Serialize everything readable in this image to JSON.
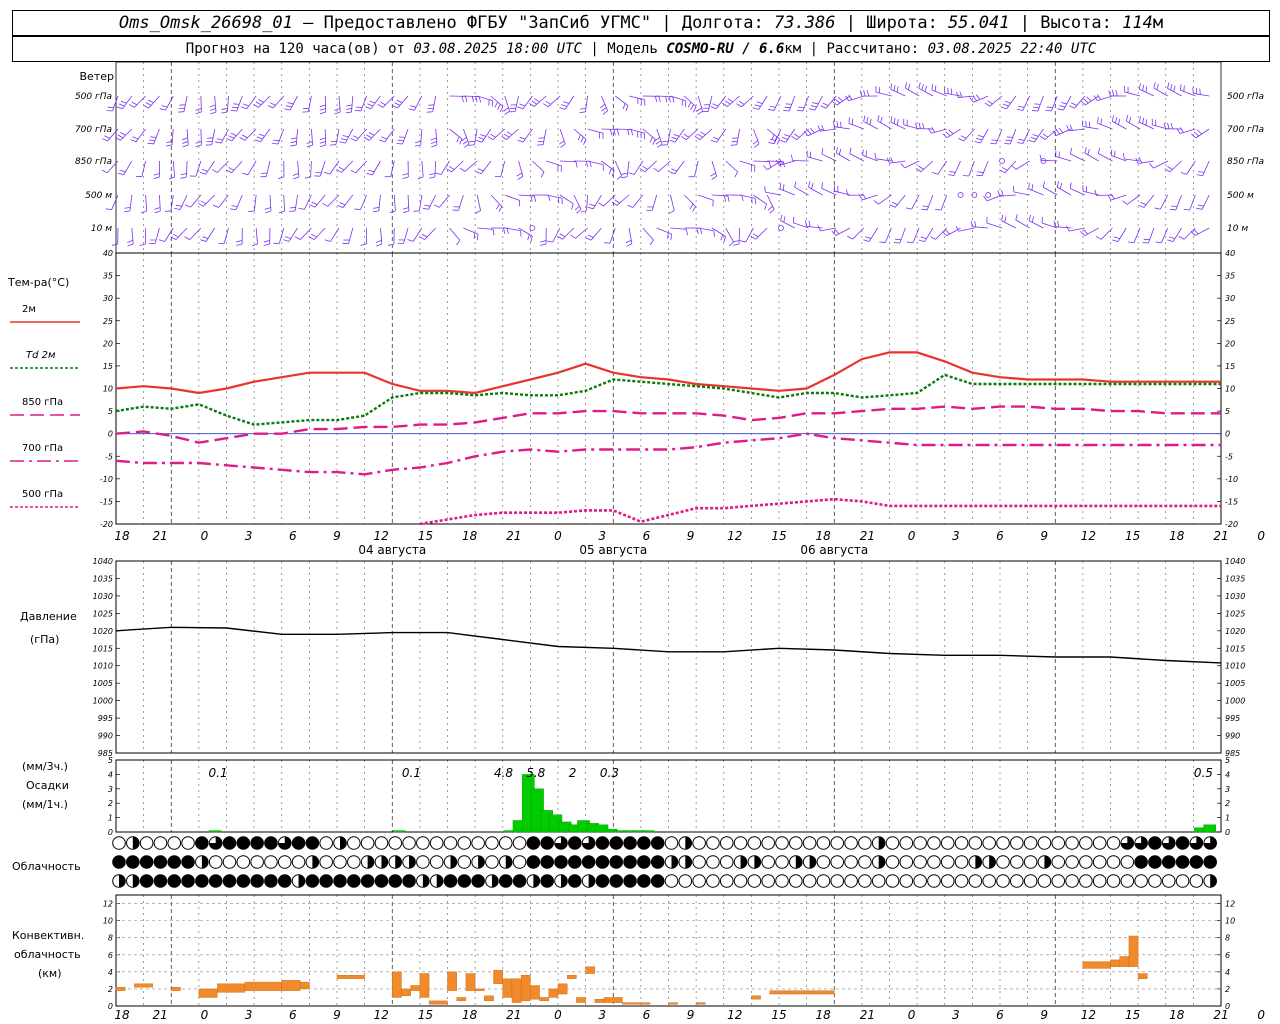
{
  "header": {
    "line1": {
      "station": "Oms_Omsk_26698_01",
      "provider": "– Предоставлено ФГБУ \"ЗапСиб УГМС\" |",
      "lon_label": "Долгота:",
      "lon": "73.386",
      "lat_label": "| Широта:",
      "lat": "55.041",
      "alt_label": "| Высота:",
      "alt": "114",
      "alt_unit": "м"
    },
    "line2": {
      "prefix": "Прогноз на 120 часа(ов) от",
      "start": "03.08.2025 18:00 UTC",
      "model_label": "| Модель",
      "model": "COSMO-RU / 6.6",
      "model_unit": "км",
      "calc_label": "| Рассчитано:",
      "calc": "03.08.2025 22:40 UTC"
    }
  },
  "time_axis": {
    "hour_labels": [
      "18",
      "21",
      "0",
      "3",
      "6",
      "9",
      "12",
      "15",
      "18",
      "21",
      "0",
      "3",
      "6",
      "9",
      "12",
      "15",
      "18",
      "21",
      "0",
      "3",
      "6",
      "9",
      "12",
      "15",
      "18",
      "21",
      "0"
    ],
    "day_labels": [
      "04 августа",
      "05 августа",
      "06 августа"
    ]
  },
  "wind_panel": {
    "title": "Ветер",
    "levels": [
      "500 гПа",
      "700 гПа",
      "850 гПа",
      "500 м",
      "10 м"
    ],
    "color": "#7b2ff0"
  },
  "colors": {
    "t2m": "#e8342c",
    "td2m": "#0a7a0a",
    "t850": "#dd1b8b",
    "t700": "#dd1b8b",
    "t500": "#dd1b8b",
    "precip": "#00cc00",
    "convective": "#f08a2a",
    "pressure": "#000000",
    "zero_line": "#3040c8"
  },
  "temp_panel": {
    "title": "Тем-ра(°С)",
    "legend": [
      "2м",
      "Td 2м",
      "850 гПа",
      "700 гПа",
      "500 гПа"
    ],
    "yticks": [
      "40",
      "35",
      "30",
      "25",
      "20",
      "15",
      "10",
      "5",
      "0",
      "-5",
      "-10",
      "-15",
      "-20"
    ]
  },
  "pressure_panel": {
    "title1": "Давление",
    "title2": "(гПа)",
    "yticks": [
      "1040",
      "1035",
      "1030",
      "1025",
      "1020",
      "1015",
      "1010",
      "1005",
      "1000",
      "995",
      "990",
      "985"
    ]
  },
  "precip_panel": {
    "label1": "(мм/3ч.)",
    "label2": "Осадки",
    "label3": "(мм/1ч.)",
    "yticks": [
      "5",
      "4",
      "3",
      "2",
      "1",
      "0"
    ],
    "annotations": [
      "0.1",
      "0.1",
      "4.8",
      "5.8",
      "2",
      "0.3",
      "0.5"
    ]
  },
  "cloud_panel": {
    "title": "Облачность"
  },
  "conv_panel": {
    "title1": "Конвективн.",
    "title2": "облачность",
    "title3": "(км)",
    "yticks": [
      "12",
      "10",
      "8",
      "6",
      "4",
      "2",
      "0"
    ]
  },
  "chart_data": [
    {
      "type": "line",
      "title": "Тем-ра(°С)",
      "x_hours": [
        0,
        3,
        6,
        9,
        12,
        15,
        18,
        21,
        24,
        27,
        30,
        33,
        36,
        39,
        42,
        45,
        48,
        51,
        54,
        57,
        60,
        63,
        66,
        69,
        72,
        75,
        78,
        81,
        84,
        87,
        90,
        93,
        96,
        99,
        102,
        105,
        108,
        111,
        114,
        117,
        120
      ],
      "ylim": [
        -20,
        40
      ],
      "series": [
        {
          "name": "2м",
          "values": [
            10,
            10.5,
            10,
            9,
            10,
            11.5,
            12.5,
            13.5,
            13.5,
            13.5,
            11,
            9.5,
            9.5,
            9,
            10.5,
            12,
            13.5,
            15.5,
            13.5,
            12.5,
            12,
            11,
            10.5,
            10,
            9.5,
            10,
            13,
            16.5,
            18,
            18,
            16,
            13.5,
            12.5,
            12,
            12,
            12,
            11.5,
            11.5,
            11.5,
            11.5,
            11.5
          ]
        },
        {
          "name": "Td 2м",
          "values": [
            5,
            6,
            5.5,
            6.5,
            4,
            2,
            2.5,
            3,
            3,
            4,
            8,
            9,
            9,
            8.5,
            9,
            8.5,
            8.5,
            9.5,
            12,
            11.5,
            11,
            10.5,
            10,
            9,
            8,
            9,
            9,
            8,
            8.5,
            9,
            13,
            11,
            11,
            11,
            11,
            11,
            11,
            11,
            11,
            11,
            11
          ]
        },
        {
          "name": "850 гПа",
          "values": [
            0,
            0.5,
            -0.5,
            -2,
            -1,
            0,
            0,
            1,
            1,
            1.5,
            1.5,
            2,
            2,
            2.5,
            3.5,
            4.5,
            4.5,
            5,
            5,
            4.5,
            4.5,
            4.5,
            4,
            3,
            3.5,
            4.5,
            4.5,
            5,
            5.5,
            5.5,
            6,
            5.5,
            6,
            6,
            5.5,
            5.5,
            5,
            5,
            4.5,
            4.5,
            4.5
          ]
        },
        {
          "name": "700 гПа",
          "values": [
            -6,
            -6.5,
            -6.5,
            -6.5,
            -7,
            -7.5,
            -8,
            -8.5,
            -8.5,
            -9,
            -8,
            -7.5,
            -6.5,
            -5,
            -4,
            -3.5,
            -4,
            -3.5,
            -3.5,
            -3.5,
            -3.5,
            -3,
            -2,
            -1.5,
            -1,
            0,
            -1,
            -1.5,
            -2,
            -2.5,
            -2.5,
            -2.5,
            -2.5,
            -2.5,
            -2.5,
            -2.5,
            -2.5,
            -2.5,
            -2.5,
            -2.5,
            -2.5
          ]
        },
        {
          "name": "500 гПа",
          "values": [
            null,
            null,
            null,
            null,
            null,
            null,
            null,
            null,
            null,
            null,
            null,
            -20,
            -19,
            -18,
            -17.5,
            -17.5,
            -17.5,
            -17,
            -17,
            -19.5,
            -18,
            -16.5,
            -16.5,
            -16,
            -15.5,
            -15,
            -14.5,
            -15,
            -16,
            -16,
            -16,
            -16,
            -16,
            -16,
            -16,
            -16,
            -16,
            -16,
            -16,
            -16,
            -16
          ]
        }
      ]
    },
    {
      "type": "line",
      "title": "Давление",
      "x_hours": [
        0,
        6,
        12,
        18,
        24,
        30,
        36,
        42,
        48,
        54,
        60,
        66,
        72,
        78,
        84,
        90,
        96,
        102,
        108,
        114,
        120
      ],
      "ylim": [
        985,
        1040
      ],
      "series": [
        {
          "name": "Давление",
          "values": [
            1020,
            1021,
            1020.8,
            1019,
            1019,
            1019.5,
            1019.5,
            1017.5,
            1015.5,
            1015,
            1014,
            1014,
            1015,
            1014.5,
            1013.5,
            1013,
            1013,
            1012.5,
            1012.5,
            1011.5,
            1010.8
          ]
        }
      ]
    },
    {
      "type": "bar",
      "title": "Осадки",
      "x_hours": [
        10,
        30,
        42,
        43,
        44,
        45,
        46,
        47,
        48,
        49,
        50,
        51,
        52,
        53,
        54,
        55,
        56,
        57,
        117,
        118
      ],
      "ylim": [
        0,
        5
      ],
      "values": [
        0.1,
        0.1,
        0.1,
        0.8,
        4,
        3,
        1.5,
        1.2,
        0.7,
        0.5,
        0.8,
        0.6,
        0.5,
        0.2,
        0.1,
        0.1,
        0.1,
        0.1,
        0.3,
        0.5
      ]
    },
    {
      "type": "bar",
      "title": "Конвективн. облачность",
      "bars": [
        {
          "x": [
            0,
            1
          ],
          "base": 1.8,
          "top": 2.2
        },
        {
          "x": [
            2,
            4
          ],
          "base": 2.2,
          "top": 2.6
        },
        {
          "x": [
            6,
            7
          ],
          "base": 1.8,
          "top": 2.2
        },
        {
          "x": [
            9,
            11
          ],
          "base": 1.0,
          "top": 2.0
        },
        {
          "x": [
            11,
            14
          ],
          "base": 1.6,
          "top": 2.6
        },
        {
          "x": [
            14,
            18
          ],
          "base": 1.8,
          "top": 2.8
        },
        {
          "x": [
            18,
            20
          ],
          "base": 1.8,
          "top": 3.0
        },
        {
          "x": [
            20,
            21
          ],
          "base": 2.0,
          "top": 2.8
        },
        {
          "x": [
            24,
            27
          ],
          "base": 3.2,
          "top": 3.6
        },
        {
          "x": [
            30,
            31
          ],
          "base": 1.0,
          "top": 4.0
        },
        {
          "x": [
            31,
            32
          ],
          "base": 1.2,
          "top": 2.0
        },
        {
          "x": [
            32,
            33
          ],
          "base": 1.8,
          "top": 2.4
        },
        {
          "x": [
            33,
            34
          ],
          "base": 1.0,
          "top": 3.8
        },
        {
          "x": [
            34,
            36
          ],
          "base": 0.2,
          "top": 0.6
        },
        {
          "x": [
            36,
            37
          ],
          "base": 1.8,
          "top": 4.0
        },
        {
          "x": [
            37,
            38
          ],
          "base": 0.6,
          "top": 1.0
        },
        {
          "x": [
            38,
            39
          ],
          "base": 1.8,
          "top": 3.8
        },
        {
          "x": [
            39,
            40
          ],
          "base": 1.8,
          "top": 2.0
        },
        {
          "x": [
            40,
            41
          ],
          "base": 0.6,
          "top": 1.2
        },
        {
          "x": [
            41,
            42
          ],
          "base": 2.6,
          "top": 4.2
        },
        {
          "x": [
            42,
            43
          ],
          "base": 1.0,
          "top": 3.2
        },
        {
          "x": [
            43,
            44
          ],
          "base": 0.4,
          "top": 3.2
        },
        {
          "x": [
            44,
            45
          ],
          "base": 0.6,
          "top": 3.6
        },
        {
          "x": [
            45,
            46
          ],
          "base": 0.8,
          "top": 2.4
        },
        {
          "x": [
            46,
            47
          ],
          "base": 0.6,
          "top": 1.0
        },
        {
          "x": [
            47,
            48
          ],
          "base": 1.0,
          "top": 2.0
        },
        {
          "x": [
            48,
            49
          ],
          "base": 1.4,
          "top": 2.6
        },
        {
          "x": [
            49,
            50
          ],
          "base": 3.2,
          "top": 3.6
        },
        {
          "x": [
            50,
            51
          ],
          "base": 0.4,
          "top": 1.0
        },
        {
          "x": [
            51,
            52
          ],
          "base": 3.8,
          "top": 4.6
        },
        {
          "x": [
            52,
            53
          ],
          "base": 0.4,
          "top": 0.8
        },
        {
          "x": [
            53,
            55
          ],
          "base": 0.4,
          "top": 1.0
        },
        {
          "x": [
            55,
            58
          ],
          "base": 0.2,
          "top": 0.4
        },
        {
          "x": [
            60,
            61
          ],
          "base": 0.2,
          "top": 0.4
        },
        {
          "x": [
            63,
            64
          ],
          "base": 0.2,
          "top": 0.4
        },
        {
          "x": [
            69,
            70
          ],
          "base": 0.8,
          "top": 1.2
        },
        {
          "x": [
            71,
            78
          ],
          "base": 1.4,
          "top": 1.8
        },
        {
          "x": [
            105,
            108
          ],
          "base": 4.4,
          "top": 5.2
        },
        {
          "x": [
            108,
            109
          ],
          "base": 4.6,
          "top": 5.4
        },
        {
          "x": [
            109,
            110
          ],
          "base": 4.6,
          "top": 5.8
        },
        {
          "x": [
            110,
            111
          ],
          "base": 4.6,
          "top": 8.2
        },
        {
          "x": [
            111,
            112
          ],
          "base": 3.2,
          "top": 3.8
        }
      ]
    }
  ]
}
